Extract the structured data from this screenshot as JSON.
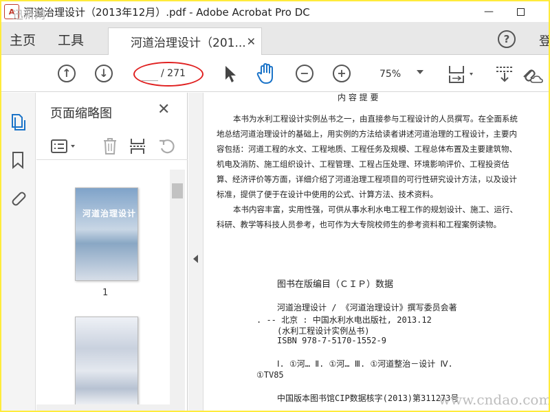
{
  "window": {
    "title": "河道治理设计（2013年12月）.pdf - Adobe Acrobat Pro DC",
    "minimize": "—",
    "watermark_left": "迅新网"
  },
  "tabs": {
    "home": "主页",
    "tools": "工具",
    "document_tab": "河道治理设计（201...",
    "close": "✕",
    "help": "?",
    "login": "登"
  },
  "toolbar": {
    "page_current": "",
    "page_total": "/ 271",
    "zoom": "75%",
    "up": "↑",
    "down": "↓",
    "zoom_out": "−",
    "zoom_in": "+"
  },
  "thumbnail_pane": {
    "title": "页面缩略图",
    "close": "✕",
    "thumb1_cover_title": "河道治理设计",
    "thumb1_label": "1"
  },
  "document": {
    "heading": "内 容 提 要",
    "para1": [
      "本书为水利工程设计实例丛书之一，由直接参与工程设计的人员撰写。在全面系统",
      "地总结河道治理设计的基础上，用实例的方法给读者讲述河道治理的工程设计，主要内",
      "容包括：河道工程的水文、工程地质、工程任务及规模、工程总体布置及主要建筑物、",
      "机电及消防、施工组织设计、工程管理、工程占压处理、环境影响评价、工程投资估",
      "算、经济评价等方面，详细介绍了河道治理工程项目的可行性研究设计方法，以及设计",
      "标准，提供了便于在设计中使用的公式、计算方法、技术资料。"
    ],
    "para2": [
      "本书内容丰富，实用性强，可供从事水利水电工程工作的规划设计、施工、运行、",
      "科研、教学等科技人员参考，也可作为大专院校师生的参考资料和工程案例读物。"
    ],
    "cip_title": "图书在版编目（ＣＩＰ）数据",
    "cip_lines": [
      "河道治理设计 / 《河道治理设计》撰写委员会著",
      ". -- 北京 : 中国水利水电出版社, 2013.12",
      "(水利工程设计实例丛书)",
      "ISBN 978-7-5170-1552-9"
    ],
    "cip_class1": "Ⅰ. ①河… Ⅱ. ①河… Ⅲ. ①河道整治－设计 Ⅳ.",
    "cip_class2": "①TV85",
    "cip_record": "中国版本图书馆CIP数据核字(2013)第311273号"
  },
  "watermark": "www.cndao.com",
  "colors": {
    "frame": "#ffeb3b",
    "annotation": "#e02020",
    "hand_tool": "#1a73c8"
  }
}
